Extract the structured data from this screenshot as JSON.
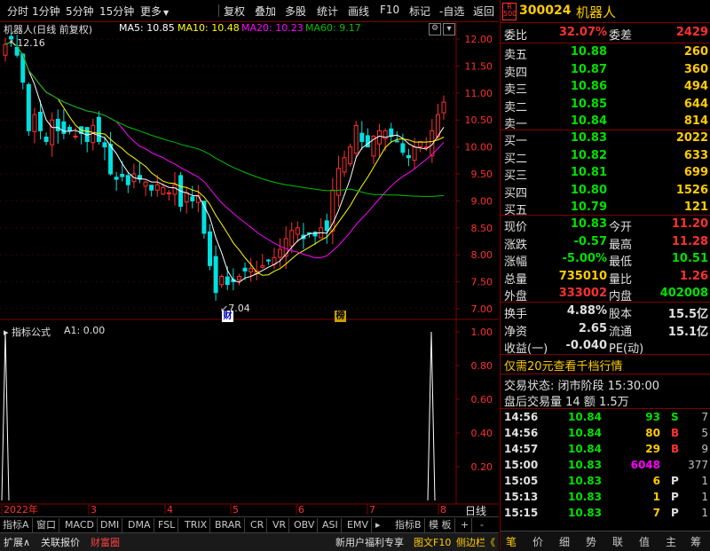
{
  "toolbar": {
    "items": [
      "分时",
      "1分钟",
      "5分钟",
      "15分钟",
      "更多",
      "复权",
      "叠加",
      "多股",
      "统计",
      "画线",
      "F10",
      "标记",
      "-自选",
      "返回"
    ]
  },
  "chart_header": {
    "name": "机器人(日线 前复权)",
    "ma5": "MA5: 10.85",
    "ma10": "MA10: 10.48",
    "ma20": "MA20: 10.23",
    "ma60": "MA60: 9.17",
    "high_mark": "12.16",
    "low_mark": "7.04",
    "badge1": "财",
    "badge2": "榜"
  },
  "indicator_header": {
    "label": "指标公式",
    "value": "A1: 0.00"
  },
  "colors": {
    "up": "#ff3030",
    "down": "#00e0e0",
    "ma5": "#ffffff",
    "ma10": "#ffff00",
    "ma20": "#ff00ff",
    "ma60": "#00c000",
    "grid": "#800000",
    "accent": "#ffcc00"
  },
  "chart_data": {
    "type": "candlestick",
    "price_axis_labels": [
      "12.00",
      "11.50",
      "11.00",
      "10.50",
      "10.00",
      "9.50",
      "9.00",
      "8.50",
      "8.00",
      "7.50",
      "7.00"
    ],
    "indicator_axis_labels": [
      "1.00",
      "0.80",
      "0.60",
      "0.40",
      "0.20"
    ],
    "x_labels": [
      "2022年",
      "3",
      "4",
      "5",
      "6",
      "7",
      "8"
    ],
    "period_label": "日线",
    "closes": [
      11.9,
      12.0,
      11.7,
      11.2,
      10.3,
      10.6,
      10.3,
      10.1,
      10.5,
      10.3,
      10.25,
      10.3,
      10.2,
      10.25,
      10.1,
      10.4,
      10.1,
      10.0,
      9.5,
      9.4,
      9.45,
      9.3,
      9.5,
      9.4,
      9.35,
      9.2,
      9.3,
      9.25,
      9.15,
      9.3,
      8.9,
      9.15,
      9.0,
      9.1,
      8.4,
      7.8,
      7.3,
      7.6,
      7.45,
      7.5,
      7.6,
      7.7,
      7.75,
      7.7,
      7.8,
      7.9,
      7.95,
      8.1,
      8.3,
      8.45,
      8.5,
      8.3,
      8.4,
      8.35,
      8.5,
      8.45,
      9.2,
      9.6,
      9.8,
      10.0,
      10.4,
      10.1,
      10.0,
      10.2,
      10.3,
      10.3,
      10.2,
      10.1,
      9.9,
      9.8,
      10.0,
      10.1,
      10.0,
      10.3,
      10.6,
      10.83
    ]
  },
  "tabs": [
    "指标A",
    "窗口",
    "MACD",
    "DMI",
    "DMA",
    "FSL",
    "TRIX",
    "BRAR",
    "CR",
    "VR",
    "OBV",
    "ASI",
    "EMV",
    "指标B",
    "模 板",
    "+",
    "-"
  ],
  "statusbar": {
    "left1": "扩展∧",
    "left2": "关联报价",
    "left3": "财富圈",
    "right1": "新用户福利专享",
    "right2": "图文F10",
    "right3": "侧边栏《"
  },
  "quote": {
    "code": "300024",
    "name": "机器人",
    "badge_top": "R",
    "badge_bottom": "500",
    "weibi_label": "委比",
    "weibi": "32.07%",
    "weicha_label": "委差",
    "weicha": "2429",
    "asks": [
      {
        "label": "卖五",
        "price": "10.88",
        "vol": "260"
      },
      {
        "label": "卖四",
        "price": "10.87",
        "vol": "360"
      },
      {
        "label": "卖三",
        "price": "10.86",
        "vol": "494"
      },
      {
        "label": "卖二",
        "price": "10.85",
        "vol": "644"
      },
      {
        "label": "卖一",
        "price": "10.84",
        "vol": "814"
      }
    ],
    "bids": [
      {
        "label": "买一",
        "price": "10.83",
        "vol": "2022"
      },
      {
        "label": "买二",
        "price": "10.82",
        "vol": "633"
      },
      {
        "label": "买三",
        "price": "10.81",
        "vol": "699"
      },
      {
        "label": "买四",
        "price": "10.80",
        "vol": "1526"
      },
      {
        "label": "买五",
        "price": "10.79",
        "vol": "121"
      }
    ],
    "stats": [
      {
        "l1": "现价",
        "v1": "10.83",
        "l2": "今开",
        "v2": "11.20"
      },
      {
        "l1": "涨跌",
        "v1": "-0.57",
        "l2": "最高",
        "v2": "11.28"
      },
      {
        "l1": "涨幅",
        "v1": "-5.00%",
        "l2": "最低",
        "v2": "10.51"
      },
      {
        "l1": "总量",
        "v1": "735010",
        "l2": "量比",
        "v2": "1.26"
      },
      {
        "l1": "外盘",
        "v1": "333002",
        "l2": "内盘",
        "v2": "402008"
      }
    ],
    "stats2": [
      {
        "l1": "换手",
        "v1": "4.88%",
        "l2": "股本",
        "v2": "15.5亿"
      },
      {
        "l1": "净资",
        "v1": "2.65",
        "l2": "流通",
        "v2": "15.1亿"
      },
      {
        "l1": "收益(一)",
        "v1": "-0.040",
        "l2": "PE(动)",
        "v2": ""
      }
    ],
    "promo": "仅需20元查看千档行情",
    "trade_state": "交易状态: 闭市阶段 15:30:00",
    "after_hours": "盘后交易量 14 额 1.5万",
    "ticks": [
      {
        "t": "14:56",
        "p": "10.84",
        "v": "93",
        "s": "S",
        "n": "7"
      },
      {
        "t": "14:56",
        "p": "10.84",
        "v": "80",
        "s": "B",
        "n": "5"
      },
      {
        "t": "14:57",
        "p": "10.84",
        "v": "29",
        "s": "B",
        "n": "9"
      },
      {
        "t": "15:00",
        "p": "10.83",
        "v": "6048",
        "s": "",
        "n": "377"
      },
      {
        "t": "15:05",
        "p": "10.83",
        "v": "6",
        "s": "P",
        "n": "1"
      },
      {
        "t": "15:13",
        "p": "10.83",
        "v": "1",
        "s": "P",
        "n": "1"
      },
      {
        "t": "15:15",
        "p": "10.83",
        "v": "7",
        "s": "P",
        "n": "1"
      }
    ],
    "bottom_tabs": [
      "笔",
      "价",
      "细",
      "势",
      "联",
      "值",
      "主",
      "筹"
    ]
  }
}
